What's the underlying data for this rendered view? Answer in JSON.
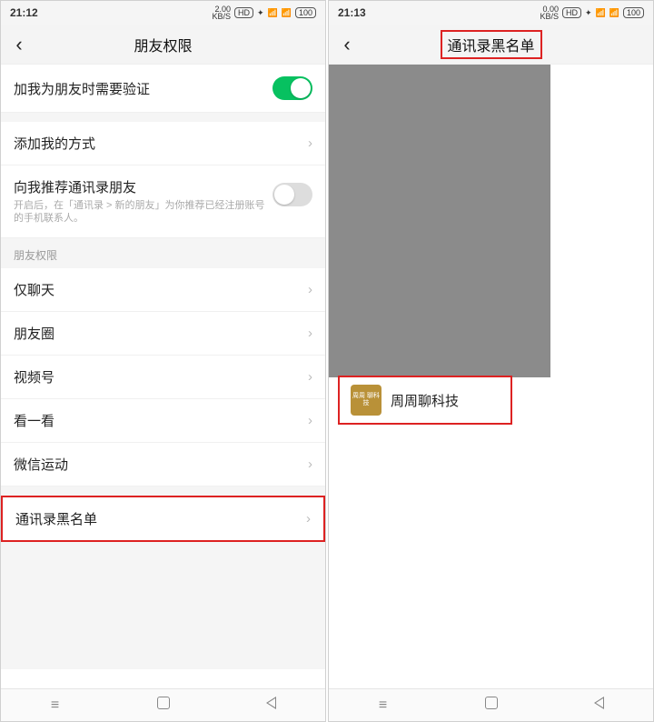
{
  "left": {
    "status": {
      "time": "21:12",
      "net": "2.00",
      "netu": "KB/S",
      "hd": "HD",
      "bat": "100"
    },
    "title": "朋友权限",
    "rows": {
      "verify": "加我为朋友时需要验证",
      "addway": "添加我的方式",
      "recommend": "向我推荐通讯录朋友",
      "recommend_desc": "开启后，在「通讯录 > 新的朋友」为你推荐已经注册账号的手机联系人。"
    },
    "section": "朋友权限",
    "perm": {
      "chat": "仅聊天",
      "moments": "朋友圈",
      "channels": "视频号",
      "topstories": "看一看",
      "werun": "微信运动",
      "blocklist": "通讯录黑名单"
    }
  },
  "right": {
    "status": {
      "time": "21:13",
      "net": "0.00",
      "netu": "KB/S",
      "hd": "HD",
      "bat": "100"
    },
    "title": "通讯录黑名单",
    "entry": {
      "avatar": "周周\n聊科技",
      "name": "周周聊科技"
    }
  }
}
